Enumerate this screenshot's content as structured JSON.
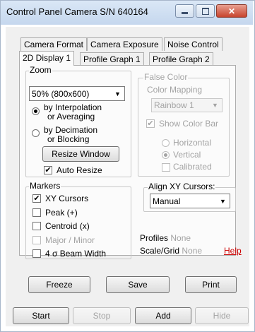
{
  "window": {
    "title": "Control Panel Camera S/N 640164",
    "minimize": "—",
    "maximize": "□",
    "close": "✕"
  },
  "tabs": {
    "row1": [
      "Camera Format",
      "Camera Exposure",
      "Noise Control"
    ],
    "row2": [
      "2D Display 1",
      "Profile Graph 1",
      "Profile Graph 2"
    ],
    "active": "2D Display 1"
  },
  "zoom": {
    "legend": "Zoom",
    "selected": "50%  (800x600)",
    "option_interp_line1": "by Interpolation",
    "option_interp_line2": "or Averaging",
    "option_decim_line1": "by Decimation",
    "option_decim_line2": "or Blocking",
    "resize_button": "Resize Window",
    "auto_resize_label": "Auto Resize"
  },
  "false_color": {
    "legend": "False Color",
    "mapping_label": "Color Mapping",
    "mapping_value": "Rainbow 1",
    "show_color_bar": "Show Color Bar",
    "horizontal": "Horizontal",
    "vertical": "Vertical",
    "calibrated": "Calibrated"
  },
  "markers": {
    "legend": "Markers",
    "xy_cursors": "XY Cursors",
    "peak": "Peak (+)",
    "centroid": "Centroid (x)",
    "major_minor": "Major / Minor",
    "beam_width": "4 σ  Beam Width"
  },
  "align": {
    "legend": "Align XY Cursors:",
    "value": "Manual"
  },
  "status": {
    "profiles_label": "Profiles",
    "profiles_value": "None",
    "scale_label": "Scale/Grid",
    "scale_value": "None",
    "help": "Help"
  },
  "buttons": {
    "freeze": "Freeze",
    "save": "Save",
    "print": "Print"
  },
  "bottom_buttons": {
    "start": "Start",
    "stop": "Stop",
    "add": "Add",
    "hide": "Hide"
  }
}
